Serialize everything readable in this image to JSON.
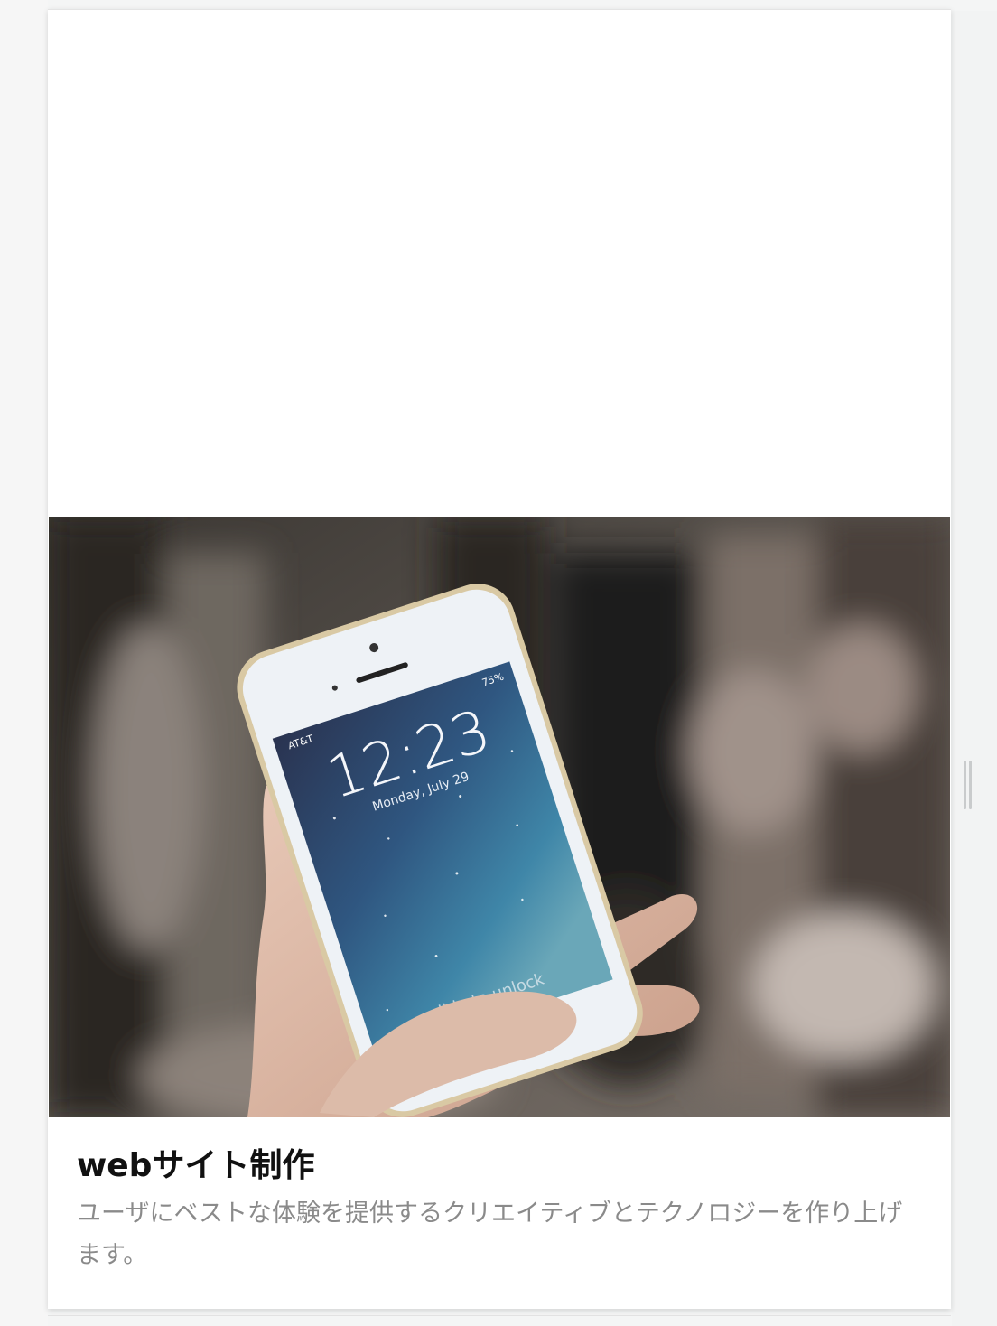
{
  "card": {
    "title": "webサイト制作",
    "description": "ユーザにベストな体験を提供するクリエイティブとテクノロジーを作り上げます。"
  },
  "photo": {
    "alt_subject": "hand-holding-smartphone",
    "phone_screen": {
      "carrier": "AT&T",
      "battery": "75%",
      "time": "12:23",
      "date": "Monday, July 29",
      "unlock_hint": "slide to unlock"
    }
  },
  "colors": {
    "page_background": "#f4f5f5",
    "card_background": "#ffffff",
    "title": "#111111",
    "description": "#8a8a8a",
    "handle": "#c9cbcc"
  }
}
